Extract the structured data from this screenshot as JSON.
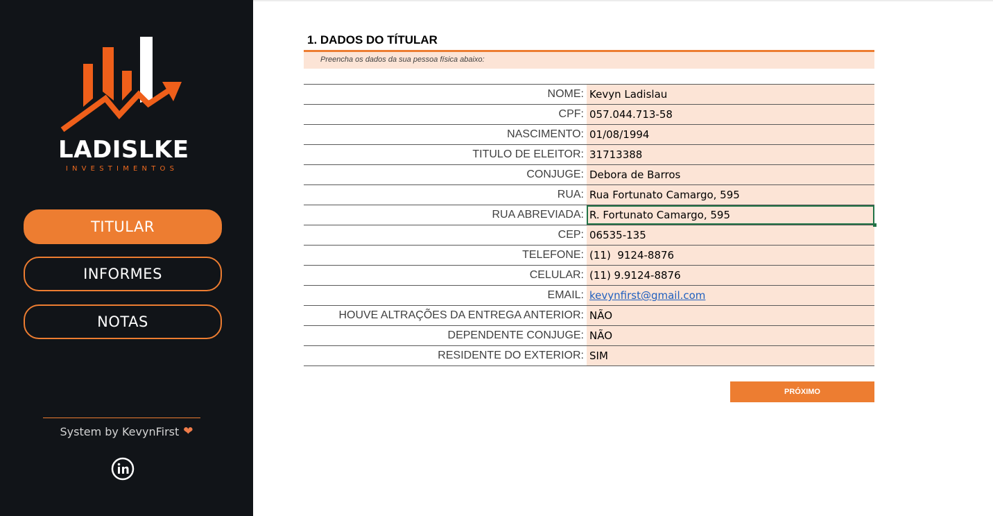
{
  "sidebar": {
    "brand_name": "LADISLKE",
    "brand_sub": "INVESTIMENTOS",
    "nav": [
      {
        "label": "TITULAR",
        "active": true
      },
      {
        "label": "INFORMES",
        "active": false
      },
      {
        "label": "NOTAS",
        "active": false
      }
    ],
    "footer_text": "System by KevynFirst",
    "footer_icon": "heart-icon",
    "social_icon": "linkedin-icon"
  },
  "main": {
    "section_title": "1. DADOS DO TÍTULAR",
    "subtitle": "Preencha os dados da sua pessoa física abaixo:",
    "fields": [
      {
        "label": "NOME:",
        "value": "Kevyn Ladislau"
      },
      {
        "label": "CPF:",
        "value": "057.044.713-58"
      },
      {
        "label": "NASCIMENTO:",
        "value": "01/08/1994"
      },
      {
        "label": "TITULO DE ELEITOR:",
        "value": "31713388"
      },
      {
        "label": "CONJUGE:",
        "value": "Debora de Barros"
      },
      {
        "label": "RUA:",
        "value": "Rua Fortunato Camargo, 595"
      },
      {
        "label": "RUA ABREVIADA:",
        "value": "R. Fortunato Camargo, 595"
      },
      {
        "label": "CEP:",
        "value": "06535-135"
      },
      {
        "label": "TELEFONE:",
        "value": "(11)  9124-8876"
      },
      {
        "label": "CELULAR:",
        "value": "(11) 9.9124-8876"
      },
      {
        "label": "EMAIL:",
        "value": "kevynfirst@gmail.com"
      },
      {
        "label": "HOUVE ALTRAÇÕES DA ENTREGA ANTERIOR:",
        "value": "NÃO"
      },
      {
        "label": "DEPENDENTE CONJUGE:",
        "value": "NÃO"
      },
      {
        "label": "RESIDENTE DO EXTERIOR:",
        "value": "SIM"
      }
    ],
    "next_button": "PRÓXIMO"
  },
  "colors": {
    "accent": "#ed7d31",
    "sidebar_bg": "#111418",
    "field_bg": "#fce4d6",
    "selection": "#217346",
    "link": "#1f5fbf"
  }
}
